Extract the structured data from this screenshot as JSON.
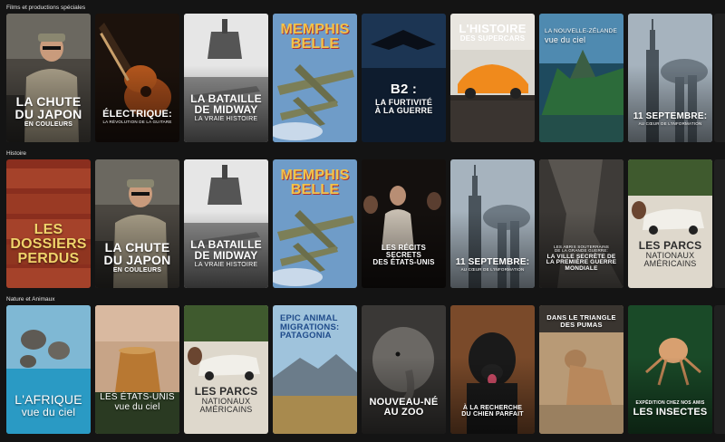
{
  "rows": [
    {
      "title": "Films et productions spéciales",
      "tiles": [
        {
          "name": "la-chute-du-japon",
          "l1": "LA CHUTE\nDU JAPON",
          "l2": "EN COULEURS"
        },
        {
          "name": "electrique",
          "l1": "ÉLECTRIQUE:",
          "l2": "LA RÉVOLUTION DE LA GUITARE"
        },
        {
          "name": "bataille-de-midway",
          "l1": "LA BATAILLE\nDE MIDWAY",
          "l2": "LA VRAIE HISTOIRE"
        },
        {
          "name": "memphis-belle",
          "l1": "MEMPHIS\nBELLE",
          "l2": ""
        },
        {
          "name": "b2",
          "l1": "B2 :",
          "l2": "LA FURTIVITÉ\nÀ LA GUERRE"
        },
        {
          "name": "histoire-des-supercars",
          "l1": "L'HISTOIRE",
          "l2": "DES SUPERCARS"
        },
        {
          "name": "nouvelle-zelande",
          "l1": "LA NOUVELLE-ZÉLANDE",
          "l2": "vue du ciel"
        },
        {
          "name": "11-septembre",
          "l1": "11 SEPTEMBRE:",
          "l2": "AU CŒUR DE L'INFORMATION"
        }
      ]
    },
    {
      "title": "Histoire",
      "tiles": [
        {
          "name": "les-dossiers-perdus",
          "l1": "LES\nDOSSIERS\nPERDUS",
          "l2": ""
        },
        {
          "name": "la-chute-du-japon",
          "l1": "LA CHUTE\nDU JAPON",
          "l2": "EN COULEURS"
        },
        {
          "name": "bataille-de-midway",
          "l1": "LA BATAILLE\nDE MIDWAY",
          "l2": "LA VRAIE HISTOIRE"
        },
        {
          "name": "memphis-belle",
          "l1": "MEMPHIS\nBELLE",
          "l2": ""
        },
        {
          "name": "recits-secrets",
          "l1": "LES RÉCITS SECRETS\nDES ÉTATS-UNIS",
          "l2": ""
        },
        {
          "name": "11-septembre",
          "l1": "11 SEPTEMBRE:",
          "l2": "AU CŒUR DE L'INFORMATION"
        },
        {
          "name": "abris-souterrains",
          "l1": "LA VILLE SECRÈTE DE\nLA PREMIÈRE GUERRE\nMONDIALE",
          "l2": "LES ABRIS SOUTERRAINS\nDE LA GRANDE GUERRE:"
        },
        {
          "name": "parcs-nationaux",
          "l1": "LES PARCS",
          "l2": "NATIONAUX\nAMÉRICAINS"
        }
      ]
    },
    {
      "title": "Nature et Animaux",
      "tiles": [
        {
          "name": "afrique-vue-du-ciel",
          "l1": "L'AFRIQUE",
          "l2": "vue du ciel"
        },
        {
          "name": "etats-unis-vue-du-ciel",
          "l1": "LES ÉTATS-UNIS",
          "l2": "vue du ciel"
        },
        {
          "name": "parcs-nationaux",
          "l1": "LES PARCS",
          "l2": "NATIONAUX\nAMÉRICAINS"
        },
        {
          "name": "epic-animal-migrations",
          "l1": "EPIC ANIMAL\nMIGRATIONS:\nPATAGONIA",
          "l2": ""
        },
        {
          "name": "nouveau-ne-au-zoo",
          "l1": "NOUVEAU-NÉ\nAU ZOO",
          "l2": ""
        },
        {
          "name": "chien-parfait",
          "l1": "À LA RECHERCHE\nDU CHIEN PARFAIT",
          "l2": ""
        },
        {
          "name": "triangle-des-pumas",
          "l1": "DANS LE TRIANGLE\nDES PUMAS",
          "l2": ""
        },
        {
          "name": "les-insectes",
          "l1": "LES INSECTES",
          "l2": "EXPÉDITION CHEZ NOS AMIS"
        }
      ]
    }
  ]
}
